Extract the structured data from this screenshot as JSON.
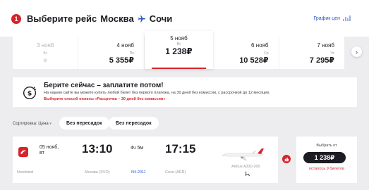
{
  "header": {
    "step": "1",
    "title_prefix": "Выберите рейс",
    "from_city": "Москва",
    "to_city": "Сочи",
    "price_graph_link": "График цен"
  },
  "dates": [
    {
      "date": "3 нояб",
      "weekday": "Вс",
      "price": "",
      "available": false
    },
    {
      "date": "4 нояб",
      "weekday": "Пн",
      "price": "5 355₽",
      "available": true
    },
    {
      "date": "5 нояб",
      "weekday": "Вт",
      "price": "1 238₽",
      "available": true,
      "selected": true
    },
    {
      "date": "6 нояб",
      "weekday": "Ср",
      "price": "10 528₽",
      "available": true
    },
    {
      "date": "7 нояб",
      "weekday": "Чт",
      "price": "7 295₽",
      "available": true
    }
  ],
  "promo": {
    "title": "Берите сейчас – заплатите потом!",
    "text": "На нашем сайте вы можете купить любой билет без первого платежа, на 30 дней без комиссии, с рассрочкой до 12 месяцев.",
    "note": "Выберите способ оплаты «Рассрочка – 30 дней без комиссии»"
  },
  "sort": {
    "label": "Сортировка: Цена",
    "filters": [
      "Без пересадок",
      "Без пересадок"
    ]
  },
  "flight": {
    "date": "05 нояб,",
    "weekday": "вт",
    "departure_time": "13:10",
    "duration": "4ч 5м",
    "arrival_time": "17:15",
    "airline": "Nordwind",
    "departure_airport": "Москва (SVO)",
    "flight_number": "N4-2011",
    "arrival_airport": "Сочи (AER)",
    "aircraft": "Airbus A330-200"
  },
  "fare": {
    "choose_label": "Выбрать от",
    "price": "1 238₽",
    "seats_left": "осталось 9 билетов"
  },
  "colors": {
    "accent": "#d8232a",
    "link": "#2a56c6",
    "dark": "#1c1c22"
  }
}
